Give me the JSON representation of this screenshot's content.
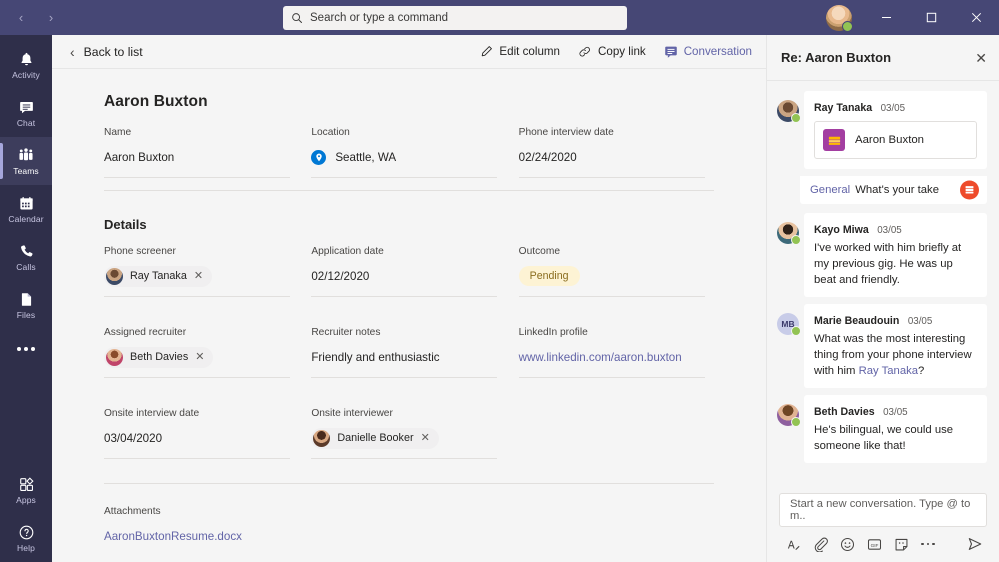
{
  "titlebar": {
    "back_arrow": "‹",
    "forward_arrow": "›",
    "search_placeholder": "Search or type a command",
    "search_icon": "search-icon",
    "minimize": "–",
    "maximize": "▫",
    "close": "✕"
  },
  "rail": {
    "items": [
      {
        "label": "Activity",
        "icon": "bell-icon",
        "active": false
      },
      {
        "label": "Chat",
        "icon": "chat-icon",
        "active": false
      },
      {
        "label": "Teams",
        "icon": "teams-icon",
        "active": true
      },
      {
        "label": "Calendar",
        "icon": "calendar-icon",
        "active": false
      },
      {
        "label": "Calls",
        "icon": "phone-icon",
        "active": false
      },
      {
        "label": "Files",
        "icon": "file-icon",
        "active": false
      }
    ],
    "more_label": "more-options-icon",
    "bottom": [
      {
        "label": "Apps",
        "icon": "apps-icon"
      },
      {
        "label": "Help",
        "icon": "help-icon"
      }
    ]
  },
  "commandbar": {
    "back_label": "Back to list",
    "back_chevron": "‹",
    "edit_column": "Edit column",
    "copy_link": "Copy link",
    "conversation": "Conversation"
  },
  "detail": {
    "title": "Aaron Buxton",
    "top_fields": [
      {
        "label": "Name",
        "value": "Aaron Buxton"
      },
      {
        "label": "Location",
        "value": "Seattle, WA"
      },
      {
        "label": "Phone interview date",
        "value": "02/24/2020"
      }
    ],
    "details_heading": "Details",
    "phone_screener": {
      "label": "Phone screener",
      "person": "Ray Tanaka"
    },
    "application_date": {
      "label": "Application date",
      "value": "02/12/2020"
    },
    "outcome": {
      "label": "Outcome",
      "value": "Pending"
    },
    "assigned_recruiter": {
      "label": "Assigned recruiter",
      "person": "Beth Davies"
    },
    "recruiter_notes": {
      "label": "Recruiter notes",
      "value": "Friendly and enthusiastic"
    },
    "linkedin": {
      "label": "LinkedIn profile",
      "value": "www.linkedin.com/aaron.buxton"
    },
    "onsite_date": {
      "label": "Onsite interview date",
      "value": "03/04/2020"
    },
    "onsite_interviewer": {
      "label": "Onsite interviewer",
      "person": "Danielle Booker"
    },
    "attachments": {
      "label": "Attachments",
      "value": "AaronBuxtonResume.docx"
    },
    "remove_label": "✕"
  },
  "conversation": {
    "title": "Re: Aaron Buxton",
    "close_icon": "✕",
    "messages": [
      {
        "author": "Ray Tanaka",
        "time": "03/05",
        "card_title": "Aaron Buxton",
        "type": "card"
      },
      {
        "author": "Kayo Miwa",
        "time": "03/05",
        "text": "I've worked with him briefly at my previous gig. He was up beat and friendly.",
        "type": "text"
      },
      {
        "author": "Marie Beaudouin",
        "time": "03/05",
        "text_before": "What was the most interesting thing from your phone interview with him ",
        "mention": "Ray Tanaka",
        "text_after": "?",
        "initials": "MB",
        "type": "mention"
      },
      {
        "author": "Beth Davies",
        "time": "03/05",
        "text": "He's bilingual, we could use someone like that!",
        "type": "text"
      }
    ],
    "reply": {
      "channel": "General",
      "text": "What's your take",
      "bot_icon": "app-bot-icon"
    },
    "compose": {
      "placeholder": "Start a new conversation. Type @ to m..",
      "tools": [
        {
          "name": "format-icon"
        },
        {
          "name": "attach-icon"
        },
        {
          "name": "emoji-icon"
        },
        {
          "name": "giphy-icon"
        },
        {
          "name": "sticker-icon"
        },
        {
          "name": "more-options-icon"
        }
      ],
      "send": {
        "name": "send-icon"
      }
    }
  },
  "colors": {
    "brand_purple": "#464775",
    "rail_dark": "#2f2f4a",
    "accent": "#6264a7",
    "pending_bg": "#fdf3d4",
    "pending_fg": "#8a6d1e",
    "presence_green": "#92c353",
    "link": "#6264a7"
  }
}
